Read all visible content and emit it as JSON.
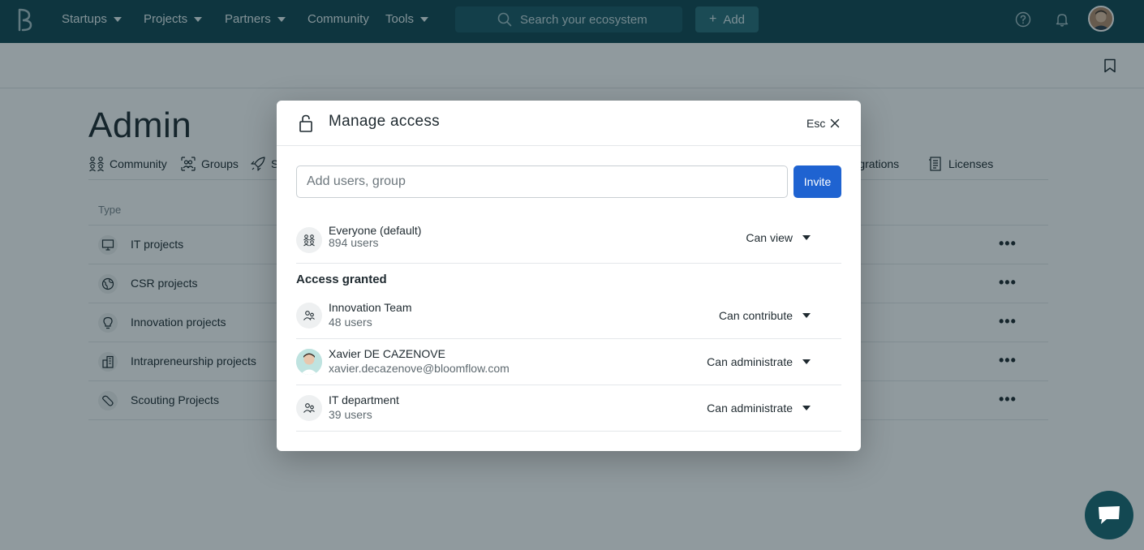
{
  "topnav": {
    "items": [
      {
        "label": "Startups",
        "dropdown": true
      },
      {
        "label": "Projects",
        "dropdown": true
      },
      {
        "label": "Partners",
        "dropdown": true
      },
      {
        "label": "Community",
        "dropdown": false
      },
      {
        "label": "Tools",
        "dropdown": true
      }
    ],
    "search_placeholder": "Search your ecosystem",
    "add_label": "Add"
  },
  "page": {
    "title": "Admin",
    "tabs": [
      {
        "label": "Community",
        "icon": "community-icon"
      },
      {
        "label": "Groups",
        "icon": "groups-icon"
      },
      {
        "label": "S",
        "icon": "rocket-icon"
      },
      {
        "label": "Integrations",
        "icon": "integrations-icon"
      },
      {
        "label": "Licenses",
        "icon": "licenses-icon"
      }
    ],
    "table": {
      "column_type": "Type",
      "rows": [
        {
          "label": "IT projects",
          "icon": "monitor-icon"
        },
        {
          "label": "CSR projects",
          "icon": "globe-icon"
        },
        {
          "label": "Innovation projects",
          "icon": "lightbulb-icon"
        },
        {
          "label": "Intrapreneurship projects",
          "icon": "buildings-icon"
        },
        {
          "label": "Scouting Projects",
          "icon": "wrench-icon"
        }
      ]
    }
  },
  "modal": {
    "title": "Manage access",
    "esc_label": "Esc",
    "input_placeholder": "Add users, group",
    "invite_label": "Invite",
    "default_access": {
      "name": "Everyone (default)",
      "sub": "894 users",
      "permission": "Can view"
    },
    "section_title": "Access granted",
    "granted": [
      {
        "name": "Innovation Team",
        "sub": "48 users",
        "permission": "Can contribute",
        "type": "group"
      },
      {
        "name": "Xavier DE CAZENOVE",
        "sub": "xavier.decazenove@bloomflow.com",
        "permission": "Can administrate",
        "type": "user"
      },
      {
        "name": "IT department",
        "sub": "39 users",
        "permission": "Can administrate",
        "type": "group"
      }
    ]
  },
  "colors": {
    "topbar": "#134852",
    "primary_button": "#1f63d1",
    "overlay": "rgba(8, 30, 40, 0.45)"
  }
}
